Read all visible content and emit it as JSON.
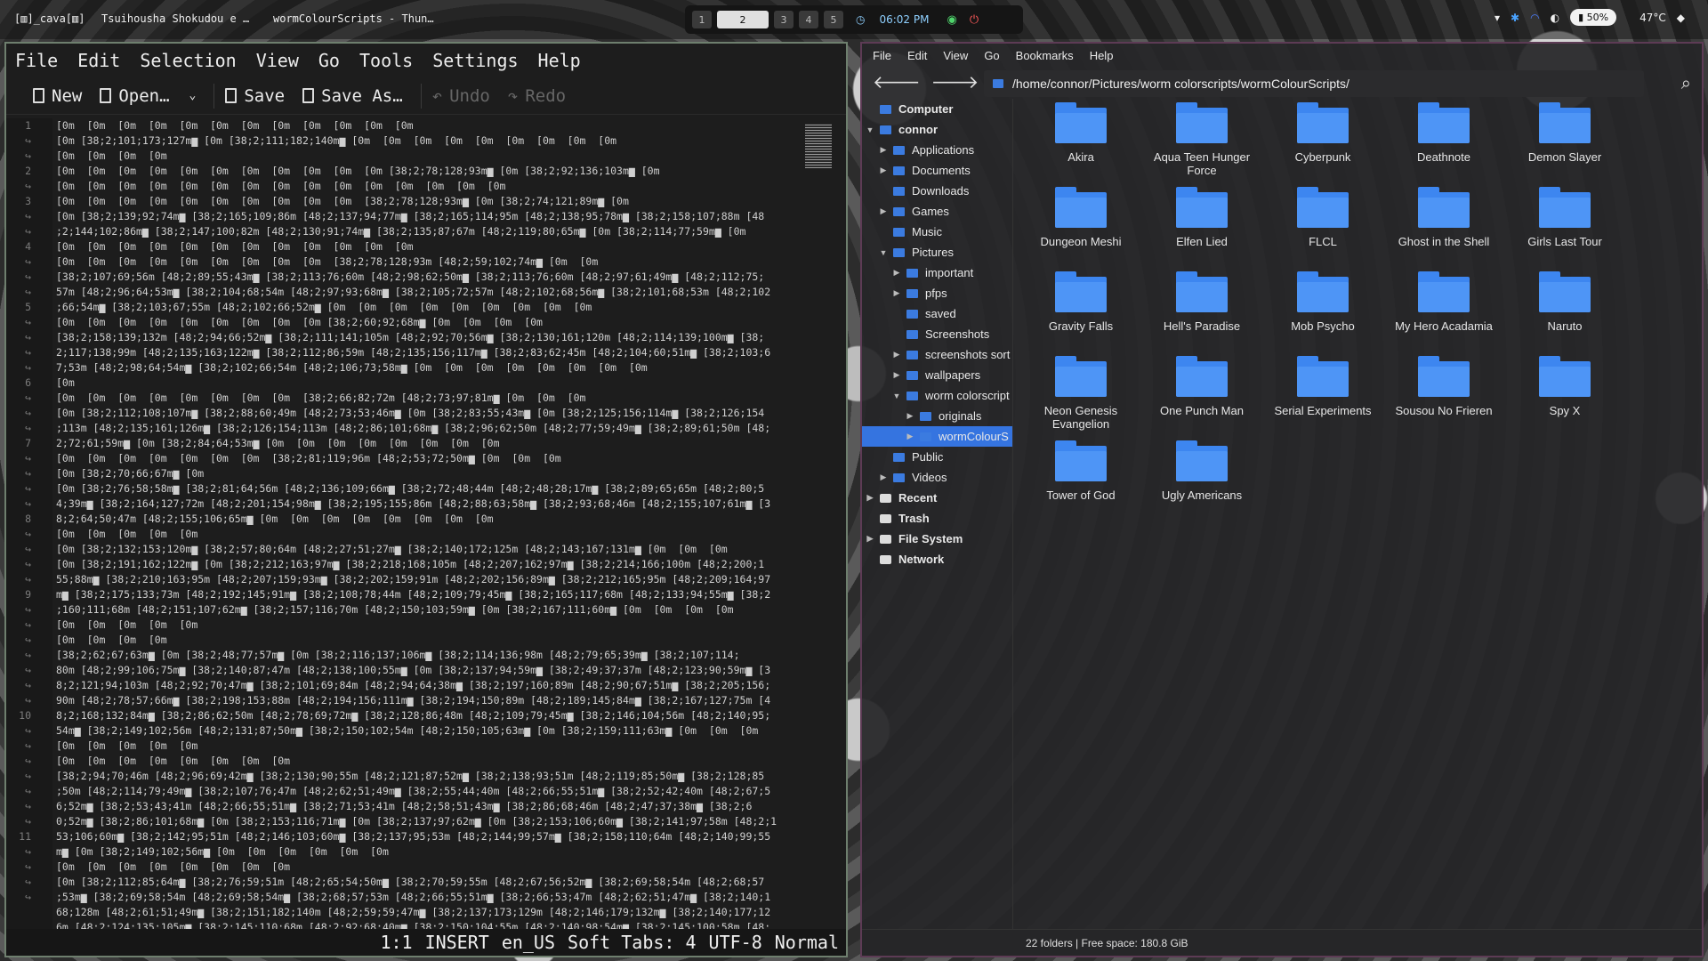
{
  "topbar": {
    "app_name": "[▥]_cava[▥]",
    "window1": "Tsuihousha Shokudou e …",
    "window2": "wormColourScripts - Thun…",
    "workspaces": [
      "1",
      "2",
      "3",
      "4",
      "5"
    ],
    "active_workspace": "2",
    "clock": "06:02 PM",
    "battery": "50%",
    "temperature": "47°C"
  },
  "editor": {
    "menu": [
      "File",
      "Edit",
      "Selection",
      "View",
      "Go",
      "Tools",
      "Settings",
      "Help"
    ],
    "toolbar": {
      "new": "New",
      "open": "Open…",
      "save": "Save",
      "save_as": "Save As…",
      "undo": "Undo",
      "redo": "Redo"
    },
    "gutter": [
      "1",
      "↪",
      "↪",
      "2",
      "↪",
      "3",
      "↪",
      "↪",
      "4",
      "↪",
      "↪",
      "↪",
      "5",
      "↪",
      "↪",
      "↪",
      "↪",
      "6",
      "↪",
      "↪",
      "↪",
      "7",
      "↪",
      "↪",
      "↪",
      "↪",
      "8",
      "↪",
      "↪",
      "↪",
      "↪",
      "9",
      "↪",
      "↪",
      "↪",
      "↪",
      "↪",
      "↪",
      "↪",
      "10",
      "↪",
      "↪",
      "↪",
      "↪",
      "↪",
      "↪",
      "↪",
      "11",
      "↪",
      "↪",
      "↪",
      "↪"
    ],
    "code_lines": [
      "[0m  [0m  [0m  [0m  [0m  [0m  [0m  [0m  [0m  [0m  [0m  [0m",
      "[0m [38;2;101;173;127m▆ [0m [38;2;111;182;140m▆ [0m  [0m  [0m  [0m  [0m  [0m  [0m  [0m  [0m",
      "[0m  [0m  [0m  [0m",
      "[0m  [0m  [0m  [0m  [0m  [0m  [0m  [0m  [0m  [0m  [0m [38;2;78;128;93m▆ [0m [38;2;92;136;103m▆ [0m",
      "[0m  [0m  [0m  [0m  [0m  [0m  [0m  [0m  [0m  [0m  [0m  [0m  [0m  [0m  [0m",
      "[0m  [0m  [0m  [0m  [0m  [0m  [0m  [0m  [0m  [0m  [38;2;78;128;93m▆ [0m [38;2;74;121;89m▆ [0m",
      "[0m [38;2;139;92;74m▆ [38;2;165;109;86m [48;2;137;94;77m▆ [38;2;165;114;95m [48;2;138;95;78m▆ [38;2;158;107;88m [48",
      ";2;144;102;86m▆ [38;2;147;100;82m [48;2;130;91;74m▆ [38;2;135;87;67m [48;2;119;80;65m▆ [0m [38;2;114;77;59m▆ [0m",
      "[0m  [0m  [0m  [0m  [0m  [0m  [0m  [0m  [0m  [0m  [0m  [0m",
      "[0m  [0m  [0m  [0m  [0m  [0m  [0m  [0m  [0m  [38;2;78;128;93m [48;2;59;102;74m▆ [0m  [0m",
      "[38;2;107;69;56m [48;2;89;55;43m▆ [38;2;113;76;60m [48;2;98;62;50m▆ [38;2;113;76;60m [48;2;97;61;49m▆ [48;2;112;75;",
      "57m [48;2;96;64;53m▆ [38;2;104;68;54m [48;2;97;93;68m▆ [38;2;105;72;57m [48;2;102;68;56m▆ [38;2;101;68;53m [48;2;102",
      ";66;54m▆ [38;2;103;67;55m [48;2;102;66;52m▆ [0m  [0m  [0m  [0m  [0m  [0m  [0m  [0m  [0m",
      "[0m  [0m  [0m  [0m  [0m  [0m  [0m  [0m  [0m [38;2;60;92;68m▆ [0m  [0m  [0m  [0m",
      "[38;2;158;139;132m [48;2;94;66;52m▆ [38;2;111;141;105m [48;2;92;70;56m▆ [38;2;130;161;120m [48;2;114;139;100m▆ [38;",
      "2;117;138;99m [48;2;135;163;122m▆ [38;2;112;86;59m [48;2;135;156;117m▆ [38;2;83;62;45m [48;2;104;60;51m▆ [38;2;103;6",
      "7;53m [48;2;98;64;54m▆ [38;2;102;66;54m [48;2;106;73;58m▆ [0m  [0m  [0m  [0m  [0m  [0m  [0m  [0m",
      "[0m",
      "[0m  [0m  [0m  [0m  [0m  [0m  [0m  [0m  [38;2;66;82;72m [48;2;73;97;81m▆ [0m  [0m  [0m",
      "[0m [38;2;112;108;107m▆ [38;2;88;60;49m [48;2;73;53;46m▆ [0m [38;2;83;55;43m▆ [0m [38;2;125;156;114m▆ [38;2;126;154",
      ";113m [48;2;135;161;126m▆ [38;2;126;154;113m [48;2;86;101;68m▆ [38;2;96;62;50m [48;2;77;59;49m▆ [38;2;89;61;50m [48;",
      "2;72;61;59m▆ [0m [38;2;84;64;53m▆ [0m  [0m  [0m  [0m  [0m  [0m  [0m  [0m",
      "[0m  [0m  [0m  [0m  [0m  [0m  [0m  [38;2;81;119;96m [48;2;53;72;50m▆ [0m  [0m  [0m",
      "[0m [38;2;70;66;67m▆ [0m",
      "[0m [38;2;76;58;58m▆ [38;2;81;64;56m [48;2;136;109;66m▆ [38;2;72;48;44m [48;2;48;28;17m▆ [38;2;89;65;65m [48;2;80;5",
      "4;39m▆ [38;2;164;127;72m [48;2;201;154;98m▆ [38;2;195;155;86m [48;2;88;63;58m▆ [38;2;93;68;46m [48;2;155;107;61m▆ [3",
      "8;2;64;50;47m [48;2;155;106;65m▆ [0m  [0m  [0m  [0m  [0m  [0m  [0m  [0m",
      "[0m  [0m  [0m  [0m  [0m",
      "[0m [38;2;132;153;120m▆ [38;2;57;80;64m [48;2;27;51;27m▆ [38;2;140;172;125m [48;2;143;167;131m▆ [0m  [0m  [0m",
      "[0m [38;2;191;162;122m▆ [0m [38;2;212;163;97m▆ [38;2;218;168;105m [48;2;207;162;97m▆ [38;2;214;166;100m [48;2;200;1",
      "55;88m▆ [38;2;210;163;95m [48;2;207;159;93m▆ [38;2;202;159;91m [48;2;202;156;89m▆ [38;2;212;165;95m [48;2;209;164;97",
      "m▆ [38;2;175;133;73m [48;2;192;145;91m▆ [38;2;108;78;44m [48;2;109;79;45m▆ [38;2;165;117;68m [48;2;133;94;55m▆ [38;2",
      ";160;111;68m [48;2;151;107;62m▆ [38;2;157;116;70m [48;2;150;103;59m▆ [0m [38;2;167;111;60m▆ [0m  [0m  [0m  [0m",
      "[0m  [0m  [0m  [0m  [0m",
      "[0m  [0m  [0m  [0m",
      "[38;2;62;67;63m▆ [0m [38;2;48;77;57m▆ [0m [38;2;116;137;106m▆ [38;2;114;136;98m [48;2;79;65;39m▆ [38;2;107;114;",
      "80m [48;2;99;106;75m▆ [38;2;140;87;47m [48;2;138;100;55m▆ [0m [38;2;137;94;59m▆ [38;2;49;37;37m [48;2;123;90;59m▆ [3",
      "8;2;121;94;103m [48;2;92;70;47m▆ [38;2;101;69;84m [48;2;94;64;38m▆ [38;2;197;160;89m [48;2;90;67;51m▆ [38;2;205;156;",
      "90m [48;2;78;57;66m▆ [38;2;198;153;88m [48;2;194;156;111m▆ [38;2;194;150;89m [48;2;189;145;84m▆ [38;2;167;127;75m [4",
      "8;2;168;132;84m▆ [38;2;86;62;50m [48;2;78;69;72m▆ [38;2;128;86;48m [48;2;109;79;45m▆ [38;2;146;104;56m [48;2;140;95;",
      "54m▆ [38;2;149;102;56m [48;2;131;87;50m▆ [38;2;150;102;54m [48;2;150;105;63m▆ [0m [38;2;159;111;63m▆ [0m  [0m  [0m",
      "[0m  [0m  [0m  [0m  [0m",
      "[0m  [0m  [0m  [0m  [0m  [0m  [0m  [0m",
      "[38;2;94;70;46m [48;2;96;69;42m▆ [38;2;130;90;55m [48;2;121;87;52m▆ [38;2;138;93;51m [48;2;119;85;50m▆ [38;2;128;85",
      ";50m [48;2;114;79;49m▆ [38;2;107;76;47m [48;2;62;51;49m▆ [38;2;55;44;40m [48;2;66;55;51m▆ [38;2;52;42;40m [48;2;67;5",
      "6;52m▆ [38;2;53;43;41m [48;2;66;55;51m▆ [38;2;71;53;41m [48;2;58;51;43m▆ [38;2;86;68;46m [48;2;47;37;38m▆ [38;2;6",
      "0;52m▆ [38;2;86;101;68m▆ [0m [38;2;153;116;71m▆ [0m [38;2;137;97;62m▆ [0m [38;2;153;106;60m▆ [38;2;141;97;58m [48;2;1",
      "53;106;60m▆ [38;2;142;95;51m [48;2;146;103;60m▆ [38;2;137;95;53m [48;2;144;99;57m▆ [38;2;158;110;64m [48;2;140;99;55",
      "m▆ [0m [38;2;149;102;56m▆ [0m  [0m  [0m  [0m  [0m  [0m",
      "[0m  [0m  [0m  [0m  [0m  [0m  [0m  [0m",
      "[0m [38;2;112;85;64m▆ [38;2;76;59;51m [48;2;65;54;50m▆ [38;2;70;59;55m [48;2;67;56;52m▆ [38;2;69;58;54m [48;2;68;57",
      ";53m▆ [38;2;69;58;54m [48;2;69;58;54m▆ [38;2;68;57;53m [48;2;66;55;51m▆ [38;2;66;53;47m [48;2;62;51;47m▆ [38;2;140;1",
      "68;128m [48;2;61;51;49m▆ [38;2;151;182;140m [48;2;59;59;47m▆ [38;2;137;173;129m [48;2;146;179;132m▆ [38;2;140;177;12",
      "6m [48;2;124;135;105m▆ [38;2;145;110;68m [48;2;92;68;40m▆ [38;2;150;104;55m [48;2;140;98;54m▆ [38;2;145;100;58m [48;"
    ],
    "status": {
      "cursor": "1:1",
      "mode": "INSERT",
      "language": "en_US",
      "tabs": "Soft Tabs: 4",
      "encoding": "UTF-8",
      "state": "Normal"
    }
  },
  "file_manager": {
    "menu": [
      "File",
      "Edit",
      "View",
      "Go",
      "Bookmarks",
      "Help"
    ],
    "path": "/home/connor/Pictures/worm colorscripts/wormColourScripts/",
    "sidebar": [
      {
        "label": "Computer",
        "depth": 0,
        "twisty": "",
        "icon": "computer-icon",
        "bold": true
      },
      {
        "label": "connor",
        "depth": 0,
        "twisty": "▼",
        "icon": "home-icon",
        "bold": true
      },
      {
        "label": "Applications",
        "depth": 1,
        "twisty": "▶",
        "icon": "folder-icon"
      },
      {
        "label": "Documents",
        "depth": 1,
        "twisty": "▶",
        "icon": "folder-icon"
      },
      {
        "label": "Downloads",
        "depth": 1,
        "twisty": "",
        "icon": "folder-icon"
      },
      {
        "label": "Games",
        "depth": 1,
        "twisty": "▶",
        "icon": "folder-icon"
      },
      {
        "label": "Music",
        "depth": 1,
        "twisty": "",
        "icon": "folder-icon"
      },
      {
        "label": "Pictures",
        "depth": 1,
        "twisty": "▼",
        "icon": "folder-icon"
      },
      {
        "label": "important",
        "depth": 2,
        "twisty": "▶",
        "icon": "folder-icon"
      },
      {
        "label": "pfps",
        "depth": 2,
        "twisty": "▶",
        "icon": "folder-icon"
      },
      {
        "label": "saved",
        "depth": 2,
        "twisty": "",
        "icon": "folder-icon"
      },
      {
        "label": "Screenshots",
        "depth": 2,
        "twisty": "",
        "icon": "folder-icon"
      },
      {
        "label": "screenshots sort",
        "depth": 2,
        "twisty": "▶",
        "icon": "folder-icon"
      },
      {
        "label": "wallpapers",
        "depth": 2,
        "twisty": "▶",
        "icon": "folder-icon"
      },
      {
        "label": "worm colorscript",
        "depth": 2,
        "twisty": "▼",
        "icon": "folder-icon"
      },
      {
        "label": "originals",
        "depth": 3,
        "twisty": "▶",
        "icon": "folder-icon"
      },
      {
        "label": "wormColourS",
        "depth": 3,
        "twisty": "▶",
        "icon": "folder-icon",
        "selected": true
      },
      {
        "label": "Public",
        "depth": 1,
        "twisty": "",
        "icon": "folder-icon"
      },
      {
        "label": "Videos",
        "depth": 1,
        "twisty": "▶",
        "icon": "folder-icon"
      },
      {
        "label": "Recent",
        "depth": 0,
        "twisty": "▶",
        "icon": "clock-icon",
        "bold": true
      },
      {
        "label": "Trash",
        "depth": 0,
        "twisty": "",
        "icon": "trash-icon",
        "bold": true
      },
      {
        "label": "File System",
        "depth": 0,
        "twisty": "▶",
        "icon": "drive-icon",
        "bold": true
      },
      {
        "label": "Network",
        "depth": 0,
        "twisty": "",
        "icon": "network-icon",
        "bold": true
      }
    ],
    "folders": [
      "Akira",
      "Aqua Teen Hunger Force",
      "Cyberpunk",
      "Deathnote",
      "Demon Slayer",
      "Dungeon Meshi",
      "Elfen Lied",
      "FLCL",
      "Ghost in the Shell",
      "Girls Last Tour",
      "Gravity Falls",
      "Hell's Paradise",
      "Mob Psycho",
      "My Hero Acadamia",
      "Naruto",
      "Neon Genesis Evangelion",
      "One Punch Man",
      "Serial Experiments",
      "Sousou No Frieren",
      "Spy X",
      "Tower of God",
      "Ugly Americans"
    ],
    "status": "22 folders  |  Free space: 180.8 GiB"
  }
}
